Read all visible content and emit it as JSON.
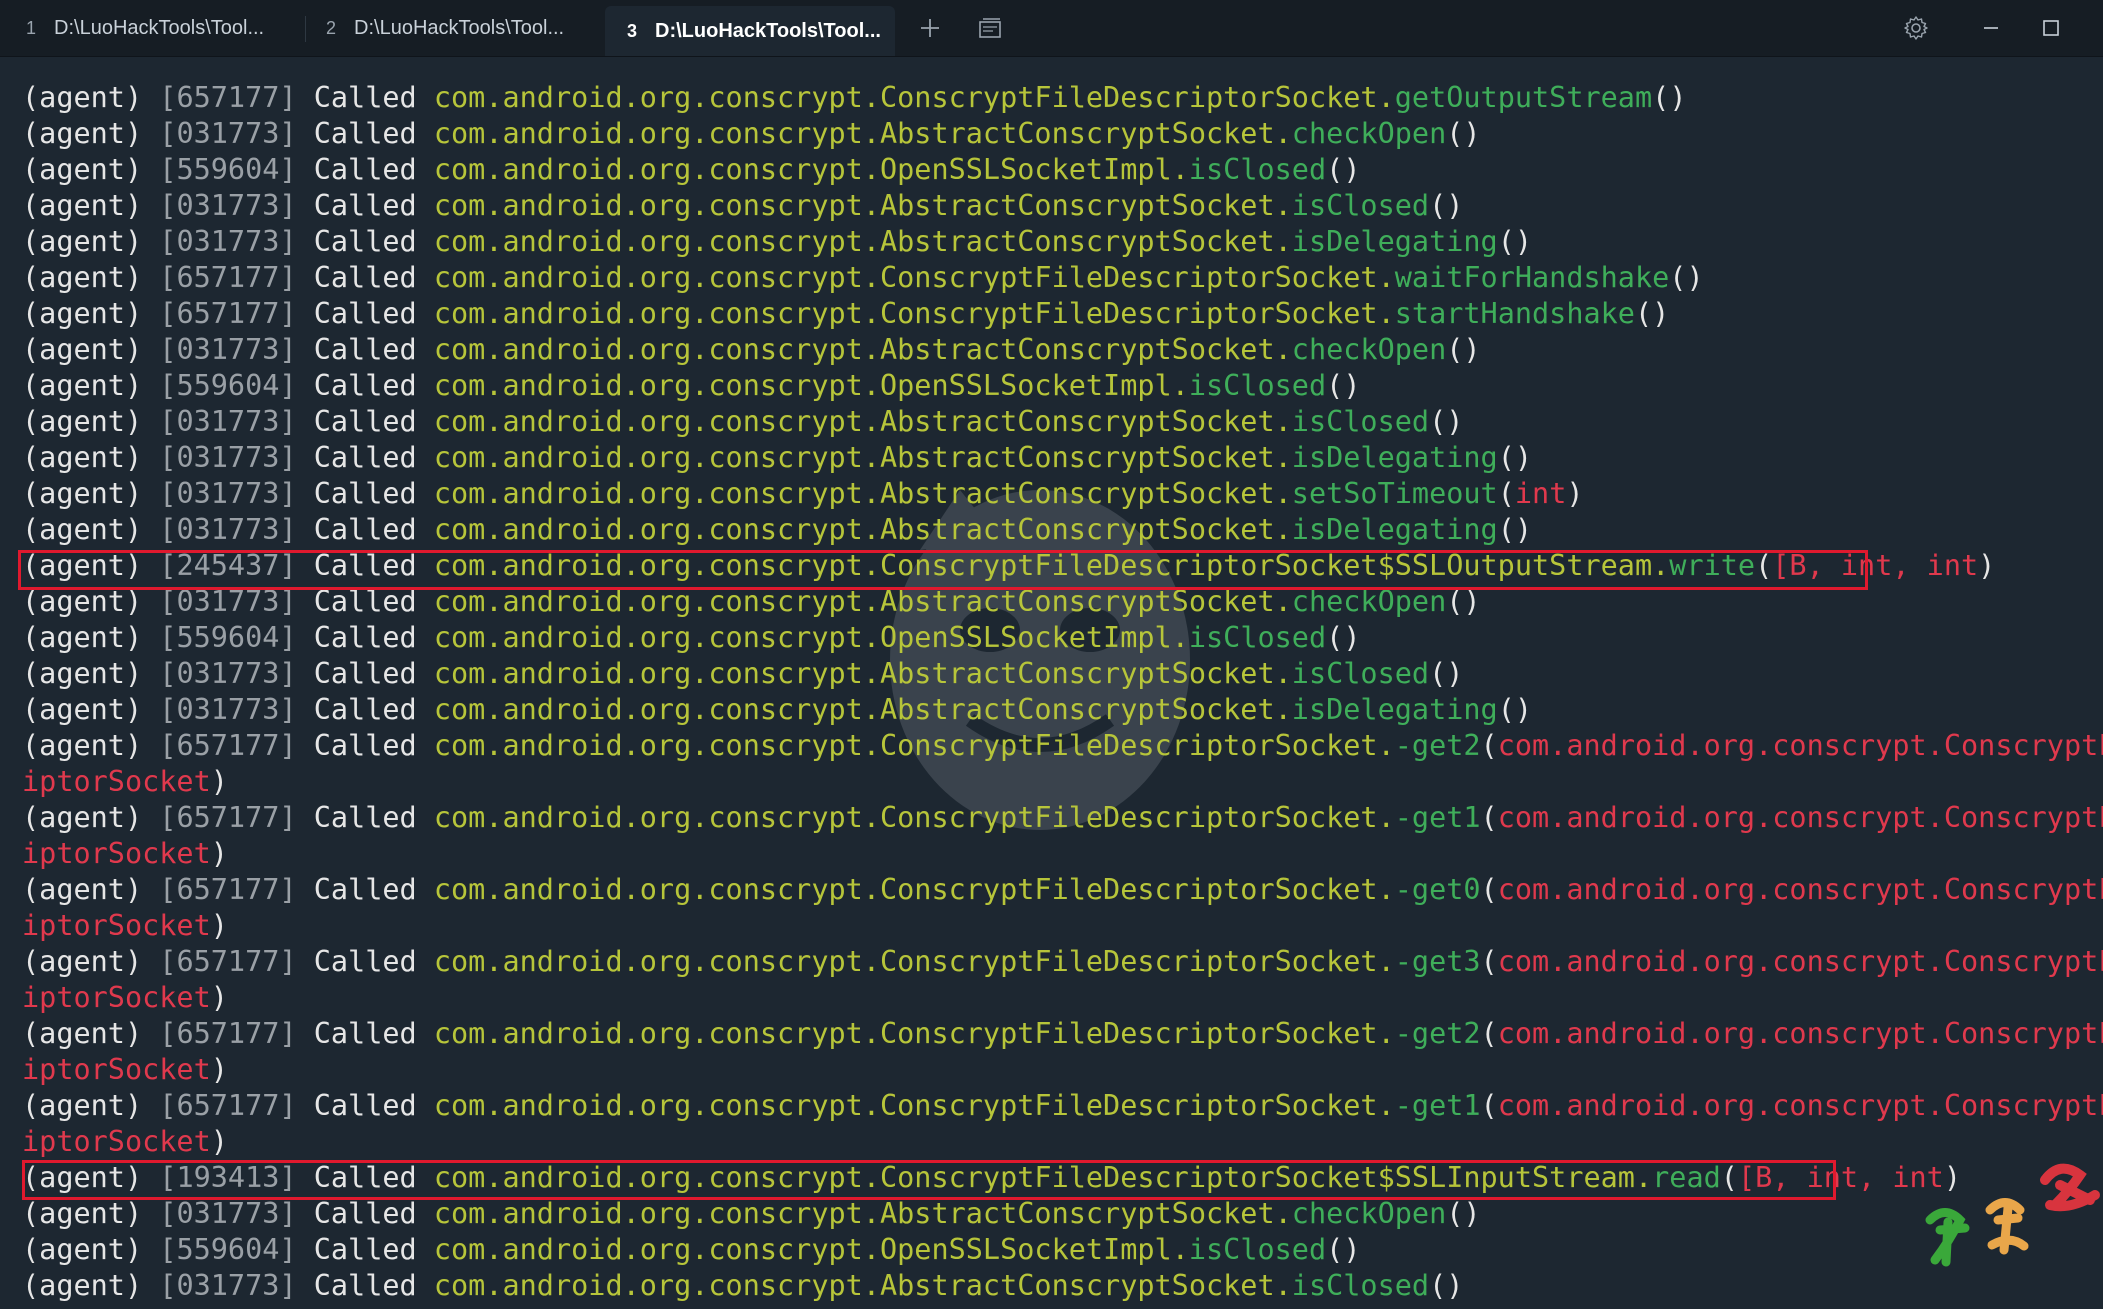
{
  "tabs": [
    {
      "number": "1",
      "label": "D:\\LuoHackTools\\Tool..."
    },
    {
      "number": "2",
      "label": "D:\\LuoHackTools\\Tool..."
    },
    {
      "number": "3",
      "label": "D:\\LuoHackTools\\Tool..."
    }
  ],
  "toolbar": {
    "new_tab_icon": "plus-icon",
    "tab_overview_icon": "window-icon",
    "settings_icon": "gear-icon",
    "minimize_icon": "minimize-icon",
    "maximize_icon": "maximize-icon"
  },
  "colors": {
    "background": "#1d2731",
    "class_name": "#b7c53a",
    "method_name": "#3fae5a",
    "arguments": "#e0394d",
    "highlight_box": "#e0192e"
  },
  "terminal_lines": [
    {
      "prefix": "(agent)",
      "pid": "[657177]",
      "called": "Called",
      "cls": "com.android.org.conscrypt.ConscryptFileDescriptorSocket",
      "method": "getOutputStream",
      "open": "(",
      "args": "",
      "close": ")"
    },
    {
      "prefix": "(agent)",
      "pid": "[031773]",
      "called": "Called",
      "cls": "com.android.org.conscrypt.AbstractConscryptSocket",
      "method": "checkOpen",
      "open": "(",
      "args": "",
      "close": ")"
    },
    {
      "prefix": "(agent)",
      "pid": "[559604]",
      "called": "Called",
      "cls": "com.android.org.conscrypt.OpenSSLSocketImpl",
      "method": "isClosed",
      "open": "(",
      "args": "",
      "close": ")"
    },
    {
      "prefix": "(agent)",
      "pid": "[031773]",
      "called": "Called",
      "cls": "com.android.org.conscrypt.AbstractConscryptSocket",
      "method": "isClosed",
      "open": "(",
      "args": "",
      "close": ")"
    },
    {
      "prefix": "(agent)",
      "pid": "[031773]",
      "called": "Called",
      "cls": "com.android.org.conscrypt.AbstractConscryptSocket",
      "method": "isDelegating",
      "open": "(",
      "args": "",
      "close": ")"
    },
    {
      "prefix": "(agent)",
      "pid": "[657177]",
      "called": "Called",
      "cls": "com.android.org.conscrypt.ConscryptFileDescriptorSocket",
      "method": "waitForHandshake",
      "open": "(",
      "args": "",
      "close": ")"
    },
    {
      "prefix": "(agent)",
      "pid": "[657177]",
      "called": "Called",
      "cls": "com.android.org.conscrypt.ConscryptFileDescriptorSocket",
      "method": "startHandshake",
      "open": "(",
      "args": "",
      "close": ")"
    },
    {
      "prefix": "(agent)",
      "pid": "[031773]",
      "called": "Called",
      "cls": "com.android.org.conscrypt.AbstractConscryptSocket",
      "method": "checkOpen",
      "open": "(",
      "args": "",
      "close": ")"
    },
    {
      "prefix": "(agent)",
      "pid": "[559604]",
      "called": "Called",
      "cls": "com.android.org.conscrypt.OpenSSLSocketImpl",
      "method": "isClosed",
      "open": "(",
      "args": "",
      "close": ")"
    },
    {
      "prefix": "(agent)",
      "pid": "[031773]",
      "called": "Called",
      "cls": "com.android.org.conscrypt.AbstractConscryptSocket",
      "method": "isClosed",
      "open": "(",
      "args": "",
      "close": ")"
    },
    {
      "prefix": "(agent)",
      "pid": "[031773]",
      "called": "Called",
      "cls": "com.android.org.conscrypt.AbstractConscryptSocket",
      "method": "isDelegating",
      "open": "(",
      "args": "",
      "close": ")"
    },
    {
      "prefix": "(agent)",
      "pid": "[031773]",
      "called": "Called",
      "cls": "com.android.org.conscrypt.AbstractConscryptSocket",
      "method": "setSoTimeout",
      "open": "(",
      "args": "int",
      "close": ")"
    },
    {
      "prefix": "(agent)",
      "pid": "[031773]",
      "called": "Called",
      "cls": "com.android.org.conscrypt.AbstractConscryptSocket",
      "method": "isDelegating",
      "open": "(",
      "args": "",
      "close": ")"
    },
    {
      "prefix": "(agent)",
      "pid": "[245437]",
      "called": "Called",
      "cls": "com.android.org.conscrypt.ConscryptFileDescriptorSocket$SSLOutputStream",
      "method": "write",
      "open": "(",
      "args": "[B, int, int",
      "close": ")"
    },
    {
      "prefix": "(agent)",
      "pid": "[031773]",
      "called": "Called",
      "cls": "com.android.org.conscrypt.AbstractConscryptSocket",
      "method": "checkOpen",
      "open": "(",
      "args": "",
      "close": ")"
    },
    {
      "prefix": "(agent)",
      "pid": "[559604]",
      "called": "Called",
      "cls": "com.android.org.conscrypt.OpenSSLSocketImpl",
      "method": "isClosed",
      "open": "(",
      "args": "",
      "close": ")"
    },
    {
      "prefix": "(agent)",
      "pid": "[031773]",
      "called": "Called",
      "cls": "com.android.org.conscrypt.AbstractConscryptSocket",
      "method": "isClosed",
      "open": "(",
      "args": "",
      "close": ")"
    },
    {
      "prefix": "(agent)",
      "pid": "[031773]",
      "called": "Called",
      "cls": "com.android.org.conscrypt.AbstractConscryptSocket",
      "method": "isDelegating",
      "open": "(",
      "args": "",
      "close": ")"
    },
    {
      "prefix": "(agent)",
      "pid": "[657177]",
      "called": "Called",
      "cls": "com.android.org.conscrypt.ConscryptFileDescriptorSocket",
      "method": "-get2",
      "open": "(",
      "args": "com.android.org.conscrypt.ConscryptFileDescr",
      "close": ""
    },
    {
      "prefix": "",
      "pid": "",
      "called": "",
      "cls": "",
      "method": "",
      "open": "",
      "args": "iptorSocket",
      "close": ")"
    },
    {
      "prefix": "(agent)",
      "pid": "[657177]",
      "called": "Called",
      "cls": "com.android.org.conscrypt.ConscryptFileDescriptorSocket",
      "method": "-get1",
      "open": "(",
      "args": "com.android.org.conscrypt.ConscryptFileDescr",
      "close": ""
    },
    {
      "prefix": "",
      "pid": "",
      "called": "",
      "cls": "",
      "method": "",
      "open": "",
      "args": "iptorSocket",
      "close": ")"
    },
    {
      "prefix": "(agent)",
      "pid": "[657177]",
      "called": "Called",
      "cls": "com.android.org.conscrypt.ConscryptFileDescriptorSocket",
      "method": "-get0",
      "open": "(",
      "args": "com.android.org.conscrypt.ConscryptFileDescr",
      "close": ""
    },
    {
      "prefix": "",
      "pid": "",
      "called": "",
      "cls": "",
      "method": "",
      "open": "",
      "args": "iptorSocket",
      "close": ")"
    },
    {
      "prefix": "(agent)",
      "pid": "[657177]",
      "called": "Called",
      "cls": "com.android.org.conscrypt.ConscryptFileDescriptorSocket",
      "method": "-get3",
      "open": "(",
      "args": "com.android.org.conscrypt.ConscryptFileDescr",
      "close": ""
    },
    {
      "prefix": "",
      "pid": "",
      "called": "",
      "cls": "",
      "method": "",
      "open": "",
      "args": "iptorSocket",
      "close": ")"
    },
    {
      "prefix": "(agent)",
      "pid": "[657177]",
      "called": "Called",
      "cls": "com.android.org.conscrypt.ConscryptFileDescriptorSocket",
      "method": "-get2",
      "open": "(",
      "args": "com.android.org.conscrypt.ConscryptFileDescr",
      "close": ""
    },
    {
      "prefix": "",
      "pid": "",
      "called": "",
      "cls": "",
      "method": "",
      "open": "",
      "args": "iptorSocket",
      "close": ")"
    },
    {
      "prefix": "(agent)",
      "pid": "[657177]",
      "called": "Called",
      "cls": "com.android.org.conscrypt.ConscryptFileDescriptorSocket",
      "method": "-get1",
      "open": "(",
      "args": "com.android.org.conscrypt.ConscryptFileDescr",
      "close": ""
    },
    {
      "prefix": "",
      "pid": "",
      "called": "",
      "cls": "",
      "method": "",
      "open": "",
      "args": "iptorSocket",
      "close": ")"
    },
    {
      "prefix": "(agent)",
      "pid": "[193413]",
      "called": "Called",
      "cls": "com.android.org.conscrypt.ConscryptFileDescriptorSocket$SSLInputStream",
      "method": "read",
      "open": "(",
      "args": "[B, int, int",
      "close": ")"
    },
    {
      "prefix": "(agent)",
      "pid": "[031773]",
      "called": "Called",
      "cls": "com.android.org.conscrypt.AbstractConscryptSocket",
      "method": "checkOpen",
      "open": "(",
      "args": "",
      "close": ")"
    },
    {
      "prefix": "(agent)",
      "pid": "[559604]",
      "called": "Called",
      "cls": "com.android.org.conscrypt.OpenSSLSocketImpl",
      "method": "isClosed",
      "open": "(",
      "args": "",
      "close": ")"
    },
    {
      "prefix": "(agent)",
      "pid": "[031773]",
      "called": "Called",
      "cls": "com.android.org.conscrypt.AbstractConscryptSocket",
      "method": "isClosed",
      "open": "(",
      "args": "",
      "close": ")"
    }
  ],
  "watermark": {
    "stamp_text": "夏洛妈"
  }
}
